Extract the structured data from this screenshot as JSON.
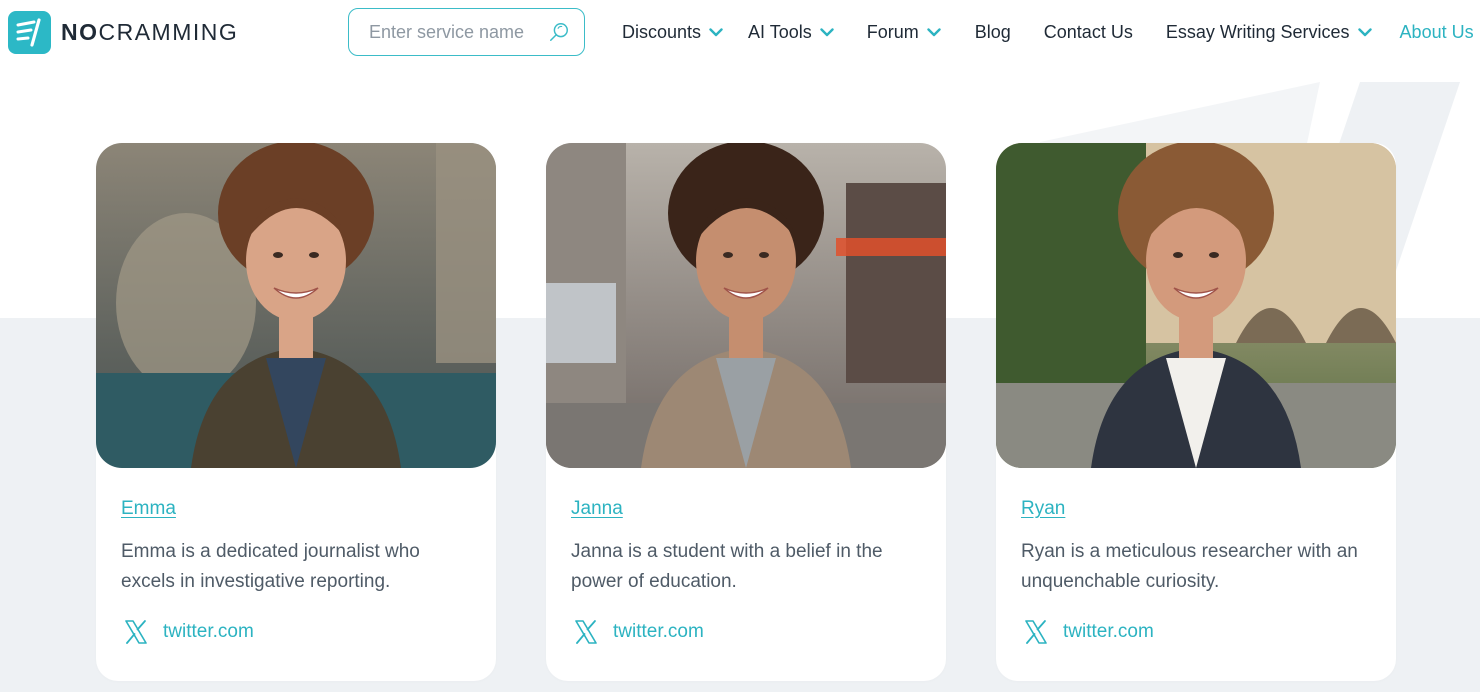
{
  "brand": {
    "name_bold": "NO",
    "name_rest": "CRAMMING",
    "accent": "#2cb8c6"
  },
  "search": {
    "placeholder": "Enter service name"
  },
  "nav": [
    {
      "label": "Discounts",
      "dropdown": true
    },
    {
      "label": "AI Tools",
      "dropdown": true
    },
    {
      "label": "Forum",
      "dropdown": true
    },
    {
      "label": "Blog",
      "dropdown": false
    },
    {
      "label": "Contact Us",
      "dropdown": false
    },
    {
      "label": "Essay Writing Services",
      "dropdown": true
    },
    {
      "label": "About Us",
      "dropdown": false,
      "active": true
    }
  ],
  "team": [
    {
      "name": "Emma",
      "bio": "Emma is a dedicated journalist who excels in investigative reporting.",
      "social": "twitter.com",
      "social_icon": "x-icon"
    },
    {
      "name": "Janna",
      "bio": "Janna is a student with a belief in the power of education.",
      "social": "twitter.com",
      "social_icon": "x-icon"
    },
    {
      "name": "Ryan",
      "bio": "Ryan is a meticulous researcher with an unquenchable curiosity.",
      "social": "twitter.com",
      "social_icon": "x-icon"
    }
  ]
}
